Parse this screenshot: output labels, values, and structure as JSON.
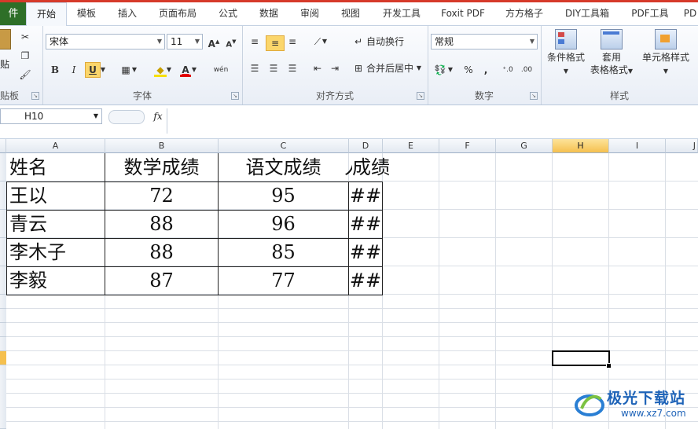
{
  "tabs": {
    "file": "件",
    "items": [
      "开始",
      "模板",
      "插入",
      "页面布局",
      "公式",
      "数据",
      "审阅",
      "视图",
      "开发工具",
      "Foxit PDF",
      "方方格子",
      "DIY工具箱",
      "PDF工具",
      "PD"
    ],
    "active": "开始"
  },
  "ribbon": {
    "clipboard": {
      "paste_label": "贴",
      "group_label": "贴板"
    },
    "font": {
      "name": "宋体",
      "size": "11",
      "group_label": "字体",
      "bold": "B",
      "italic": "I",
      "underline": "U",
      "grow": "A",
      "shrink": "A",
      "phonetic": "wén"
    },
    "alignment": {
      "wrap_text": "自动换行",
      "merge_center": "合并后居中",
      "group_label": "对齐方式"
    },
    "number": {
      "format": "常规",
      "percent": "%",
      "comma": ",",
      "group_label": "数字"
    },
    "styles": {
      "conditional": "条件格式",
      "table_line1": "套用",
      "table_line2": "表格格式",
      "cell_styles": "单元格样式",
      "group_label": "样式"
    }
  },
  "formula_bar": {
    "name_box": "H10",
    "fx": "fx",
    "content": ""
  },
  "sheet": {
    "columns": [
      "A",
      "B",
      "C",
      "D",
      "E",
      "F",
      "G",
      "H",
      "I",
      "J"
    ],
    "selected_column": "H",
    "header_row": [
      "姓名",
      "数学成绩",
      "语文成绩",
      " 成绩"
    ],
    "rows": [
      [
        "王以",
        "72",
        "95",
        "##"
      ],
      [
        "青云",
        "88",
        "96",
        "##"
      ],
      [
        "李木子",
        "88",
        "85",
        "##"
      ],
      [
        "李毅",
        "87",
        "77",
        "##"
      ]
    ],
    "d_header_visible": "成绩"
  },
  "watermark": {
    "brand": "极光下载站",
    "url": "www.xz7.com"
  }
}
